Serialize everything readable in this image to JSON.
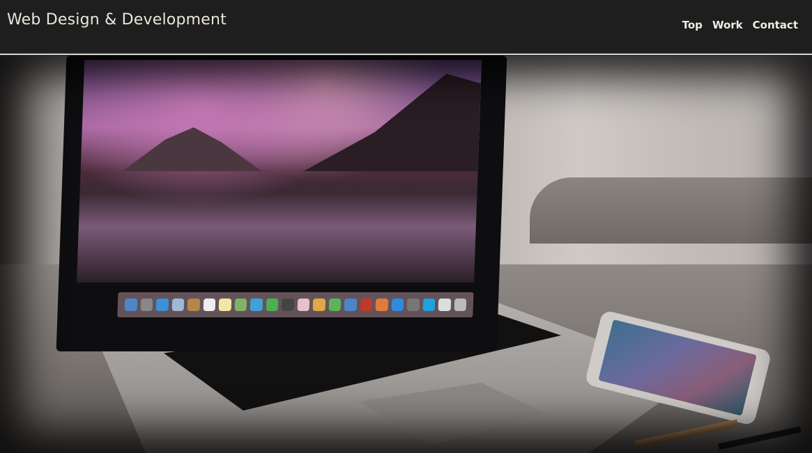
{
  "brand": {
    "title": "Web Design & Development"
  },
  "nav": {
    "items": [
      {
        "label": "Top"
      },
      {
        "label": "Work"
      },
      {
        "label": "Contact"
      }
    ]
  },
  "hero": {
    "image_subject": "laptop-and-phone-on-desk"
  },
  "colors": {
    "topbar_bg": "#1e1e1e",
    "brand_text": "#ece6dc",
    "nav_text": "#f1ebe2",
    "divider": "#d9d9d9"
  }
}
